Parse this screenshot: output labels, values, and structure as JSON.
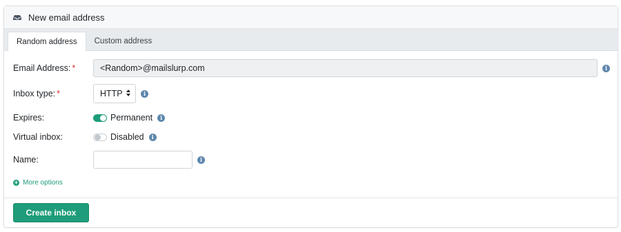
{
  "header": {
    "title": "New email address",
    "icon": "inbox-tray-icon"
  },
  "tabs": [
    {
      "label": "Random address",
      "active": true
    },
    {
      "label": "Custom address",
      "active": false
    }
  ],
  "form": {
    "email": {
      "label": "Email Address:",
      "required_mark": "*",
      "value": "<Random>@mailslurp.com"
    },
    "inbox_type": {
      "label": "Inbox type:",
      "required_mark": "*",
      "value": "HTTP"
    },
    "expires": {
      "label": "Expires:",
      "toggle_text": "Permanent",
      "on": true
    },
    "virtual": {
      "label": "Virtual inbox:",
      "toggle_text": "Disabled",
      "on": false
    },
    "name": {
      "label": "Name:",
      "value": "",
      "placeholder": ""
    },
    "more_options": "More options"
  },
  "footer": {
    "create_label": "Create inbox"
  },
  "colors": {
    "accent": "#1f9d7a",
    "info": "#5e87ad",
    "required": "#e03131"
  }
}
